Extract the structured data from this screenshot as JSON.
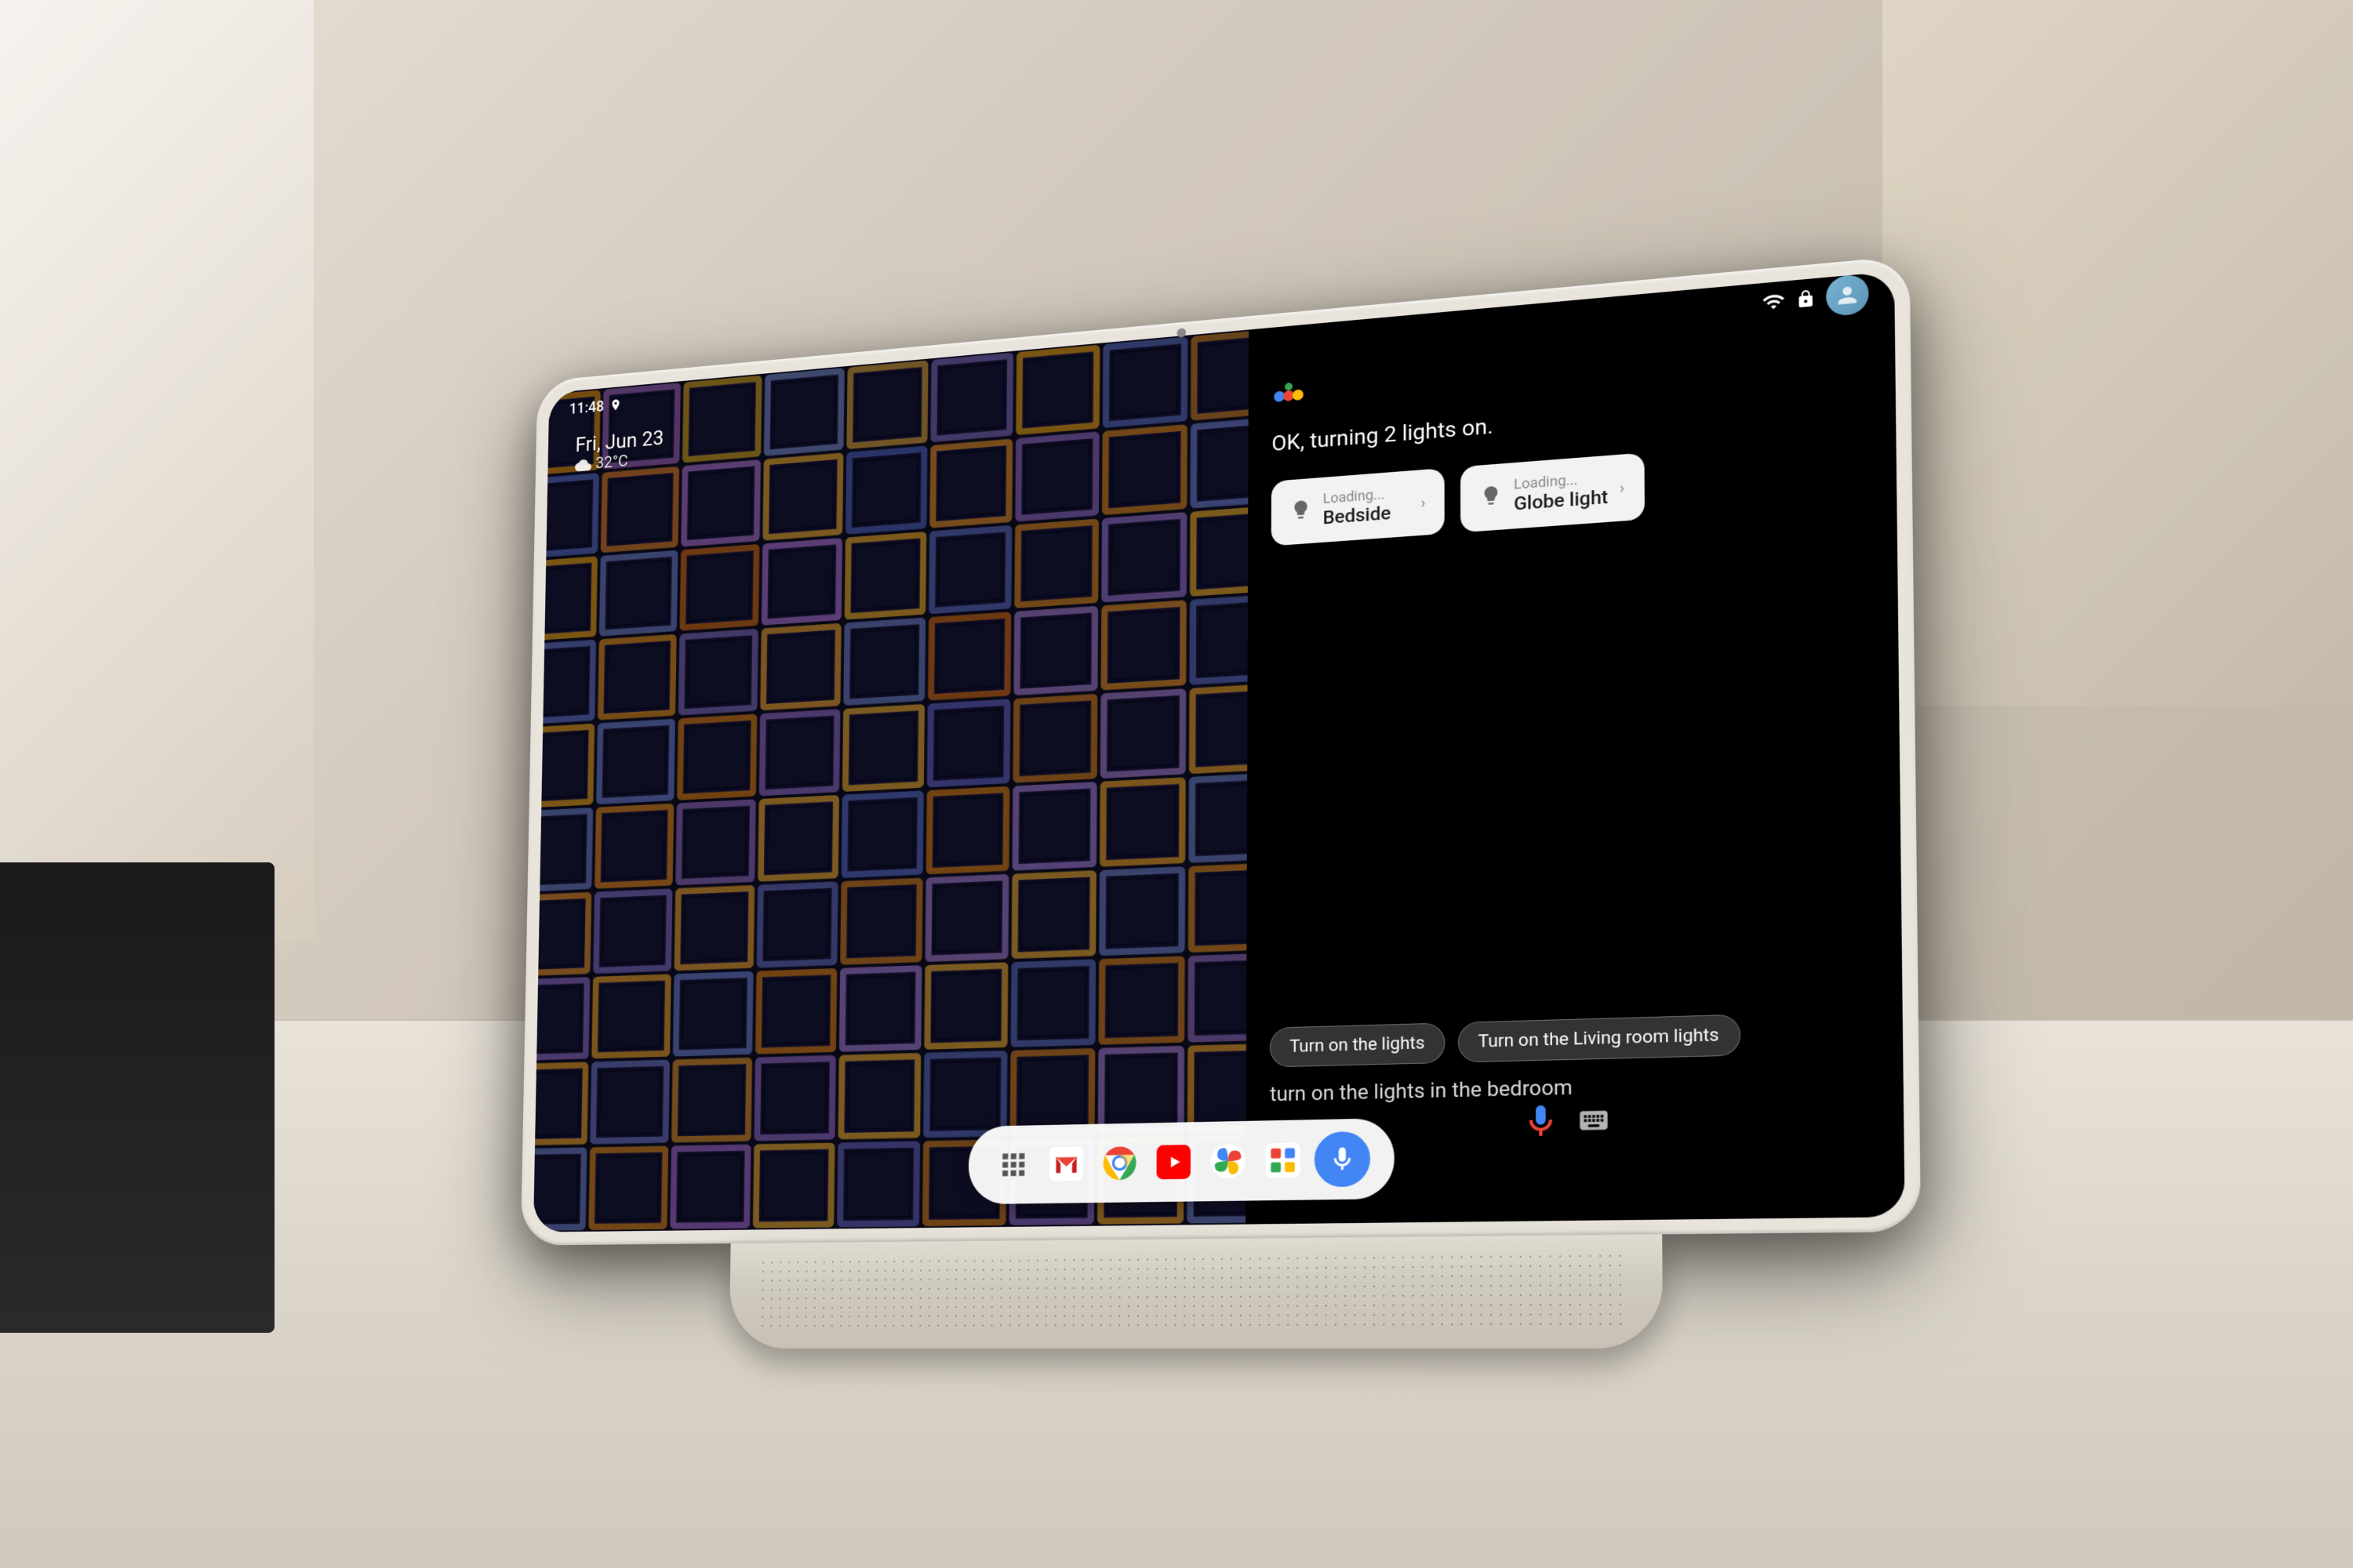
{
  "background": {
    "color": "#d0c8bc"
  },
  "tablet": {
    "deviceColor": "#e8e4dc"
  },
  "statusBar": {
    "time": "11:48",
    "wifiIcon": "wifi-icon",
    "lockIcon": "lock-icon",
    "userIcon": "user-avatar-icon"
  },
  "wallpaper": {
    "dateLabel": "Fri, Jun 23",
    "weatherIcon": "cloud-icon",
    "temperature": "32°C"
  },
  "assistant": {
    "responseText": "OK, turning 2 lights on.",
    "card1": {
      "status": "Loading...",
      "name": "Bedside",
      "icon": "lightbulb-icon",
      "arrowIcon": "chevron-right-icon"
    },
    "card2": {
      "status": "Loading...",
      "name": "Globe light",
      "icon": "lightbulb-icon",
      "arrowIcon": "chevron-right-icon"
    }
  },
  "suggestions": {
    "chip1": "Turn on the lights",
    "chip2": "Turn on the Living room lights",
    "queryText": "turn on the lights in the bedroom"
  },
  "taskbar": {
    "apps": [
      {
        "name": "google-apps-icon",
        "label": "Google Apps"
      },
      {
        "name": "gmail-icon",
        "label": "Gmail"
      },
      {
        "name": "chrome-icon",
        "label": "Chrome"
      },
      {
        "name": "youtube-icon",
        "label": "YouTube"
      },
      {
        "name": "photos-icon",
        "label": "Google Photos"
      },
      {
        "name": "google-one-icon",
        "label": "Google One"
      }
    ],
    "micButton": "google-assistant-mic"
  }
}
